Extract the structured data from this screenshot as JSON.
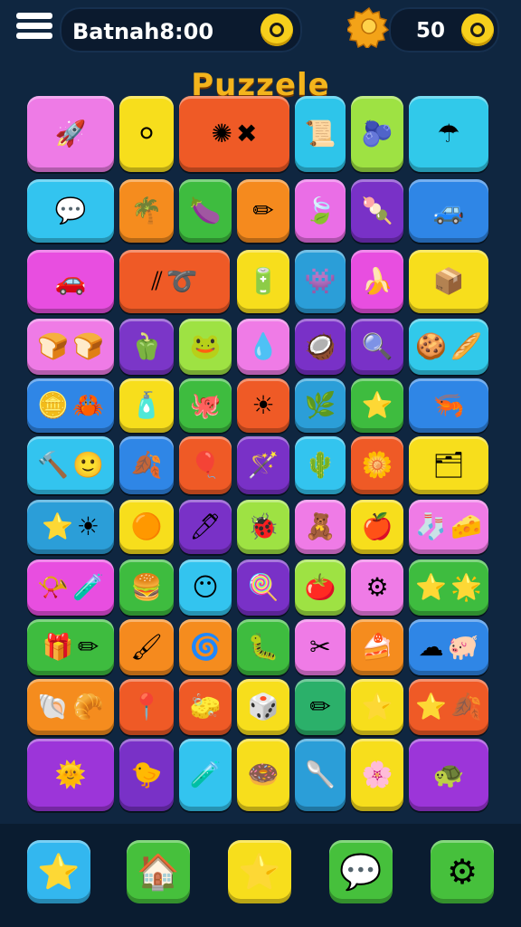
{
  "header": {
    "title_text": "Batnah8:00",
    "coins": "50"
  },
  "game_title": "Puzzele",
  "colors": {
    "background": "#0f2640",
    "title": "#f3b41c"
  },
  "tiles": [
    {
      "color": "#ee7be6",
      "icons": [
        "rocket-icon"
      ],
      "glyphs": [
        "🚀"
      ]
    },
    {
      "color": "#f7de1c",
      "icons": [
        "egg-icon"
      ],
      "glyphs": [
        "⚪"
      ]
    },
    {
      "color": "#ef5a26",
      "icons": [
        "virus-icon",
        "cross-icon"
      ],
      "glyphs": [
        "✺",
        "✖"
      ]
    },
    {
      "color": "#2ec5ea",
      "icons": [
        "scroll-icon"
      ],
      "glyphs": [
        "📜"
      ]
    },
    {
      "color": "#9ee243",
      "icons": [
        "berry-icon"
      ],
      "glyphs": [
        "🫐"
      ]
    },
    {
      "color": "#31c9ea",
      "icons": [
        "umbrella-icon"
      ],
      "glyphs": [
        "☂"
      ]
    },
    {
      "color": "#33c4ef",
      "icons": [
        "chat-bubble-icon"
      ],
      "glyphs": [
        "💬"
      ]
    },
    {
      "color": "#f58c1e",
      "icons": [
        "palm-icon"
      ],
      "glyphs": [
        "🌴"
      ]
    },
    {
      "color": "#3ebc3f",
      "icons": [
        "eggplant-icon"
      ],
      "glyphs": [
        "🍆"
      ]
    },
    {
      "color": "#f58a1e",
      "icons": [
        "pencil-icon"
      ],
      "glyphs": [
        "✏"
      ]
    },
    {
      "color": "#ea6ee6",
      "icons": [
        "leaf-icon"
      ],
      "glyphs": [
        "🍃"
      ]
    },
    {
      "color": "#7931c7",
      "icons": [
        "ice-pop-icon"
      ],
      "glyphs": [
        "🍡"
      ]
    },
    {
      "color": "#2f86e6",
      "icons": [
        "toy-car-icon"
      ],
      "glyphs": [
        "🚙"
      ]
    },
    {
      "color": "#e84ee0",
      "icons": [
        "car-icon"
      ],
      "glyphs": [
        "🚗"
      ]
    },
    {
      "color": "#ef5a26",
      "icons": [
        "sticks-icon",
        "rope-icon"
      ],
      "glyphs": [
        "⫽",
        "➰"
      ]
    },
    {
      "color": "#f7de1c",
      "icons": [
        "battery-icon"
      ],
      "glyphs": [
        "🔋"
      ]
    },
    {
      "color": "#2b9ed8",
      "icons": [
        "alien-icon"
      ],
      "glyphs": [
        "👾"
      ]
    },
    {
      "color": "#e84ee0",
      "icons": [
        "banana-icon"
      ],
      "glyphs": [
        "🍌"
      ]
    },
    {
      "color": "#f7de1c",
      "icons": [
        "box-icon"
      ],
      "glyphs": [
        "📦"
      ]
    },
    {
      "color": "#ef7be6",
      "icons": [
        "bread-icon",
        "bread-icon"
      ],
      "glyphs": [
        "🍞",
        "🍞"
      ]
    },
    {
      "color": "#7b36c8",
      "icons": [
        "pepper-icon"
      ],
      "glyphs": [
        "🫑"
      ]
    },
    {
      "color": "#9ee243",
      "icons": [
        "bird-icon"
      ],
      "glyphs": [
        "🐸"
      ]
    },
    {
      "color": "#ef7be6",
      "icons": [
        "drop-icon"
      ],
      "glyphs": [
        "💧"
      ]
    },
    {
      "color": "#7931c7",
      "icons": [
        "coconut-icon"
      ],
      "glyphs": [
        "🥥"
      ]
    },
    {
      "color": "#7931c7",
      "icons": [
        "magnifier-icon"
      ],
      "glyphs": [
        "🔍"
      ]
    },
    {
      "color": "#31c9ea",
      "icons": [
        "cookie-icon",
        "cookie-icon"
      ],
      "glyphs": [
        "🍪",
        "🥖"
      ]
    },
    {
      "color": "#2f86e6",
      "icons": [
        "coin-icon",
        "crab-icon"
      ],
      "glyphs": [
        "🪙",
        "🦀"
      ]
    },
    {
      "color": "#f7de1c",
      "icons": [
        "bottle-icon"
      ],
      "glyphs": [
        "🧴"
      ]
    },
    {
      "color": "#3ebc3f",
      "icons": [
        "octopus-icon"
      ],
      "glyphs": [
        "🐙"
      ]
    },
    {
      "color": "#ef5a26",
      "icons": [
        "sun-icon"
      ],
      "glyphs": [
        "☀"
      ]
    },
    {
      "color": "#2b9ed8",
      "icons": [
        "leaf-icon"
      ],
      "glyphs": [
        "🌿"
      ]
    },
    {
      "color": "#3ebc3f",
      "icons": [
        "star-icon"
      ],
      "glyphs": [
        "⭐"
      ]
    },
    {
      "color": "#2f86e6",
      "icons": [
        "shrimp-icon"
      ],
      "glyphs": [
        "🦐"
      ]
    },
    {
      "color": "#33c4ef",
      "icons": [
        "hammer-icon",
        "smiley-icon"
      ],
      "glyphs": [
        "🔨",
        "🙂"
      ]
    },
    {
      "color": "#2f86e6",
      "icons": [
        "leaf-drop-icon"
      ],
      "glyphs": [
        "🍂"
      ]
    },
    {
      "color": "#ef5a26",
      "icons": [
        "bulb-icon"
      ],
      "glyphs": [
        "🎈"
      ]
    },
    {
      "color": "#7931c7",
      "icons": [
        "wand-icon"
      ],
      "glyphs": [
        "🪄"
      ]
    },
    {
      "color": "#33c4ef",
      "icons": [
        "cactus-icon"
      ],
      "glyphs": [
        "🌵"
      ]
    },
    {
      "color": "#ef5a26",
      "icons": [
        "flower-icon"
      ],
      "glyphs": [
        "🌼"
      ]
    },
    {
      "color": "#f7de1c",
      "icons": [
        "card-icon"
      ],
      "glyphs": [
        "🗂"
      ]
    },
    {
      "color": "#2b9ed8",
      "icons": [
        "star-icon",
        "sun-icon"
      ],
      "glyphs": [
        "⭐",
        "☀"
      ]
    },
    {
      "color": "#f7de1c",
      "icons": [
        "balloon-icon"
      ],
      "glyphs": [
        "🟠"
      ]
    },
    {
      "color": "#7931c7",
      "icons": [
        "pen-icon"
      ],
      "glyphs": [
        "🖊"
      ]
    },
    {
      "color": "#9ee243",
      "icons": [
        "bug-icon"
      ],
      "glyphs": [
        "🐞"
      ]
    },
    {
      "color": "#ef7be6",
      "icons": [
        "toy-icon"
      ],
      "glyphs": [
        "🧸"
      ]
    },
    {
      "color": "#f7de1c",
      "icons": [
        "apple-icon"
      ],
      "glyphs": [
        "🍎"
      ]
    },
    {
      "color": "#ef7be6",
      "icons": [
        "socks-icon",
        "bread-icon"
      ],
      "glyphs": [
        "🧦",
        "🧀"
      ]
    },
    {
      "color": "#e84ee0",
      "icons": [
        "horn-icon",
        "pipe-icon"
      ],
      "glyphs": [
        "📯",
        "🧪"
      ]
    },
    {
      "color": "#3ebc3f",
      "icons": [
        "burger-icon"
      ],
      "glyphs": [
        "🍔"
      ]
    },
    {
      "color": "#33c4ef",
      "icons": [
        "face-icon"
      ],
      "glyphs": [
        "😶"
      ]
    },
    {
      "color": "#7931c7",
      "icons": [
        "lollipop-icon"
      ],
      "glyphs": [
        "🍭"
      ]
    },
    {
      "color": "#9ee243",
      "icons": [
        "apple-icon"
      ],
      "glyphs": [
        "🍅"
      ]
    },
    {
      "color": "#ef7be6",
      "icons": [
        "gear-icon"
      ],
      "glyphs": [
        "⚙"
      ]
    },
    {
      "color": "#3ebc3f",
      "icons": [
        "starfish-icon",
        "starfish-icon"
      ],
      "glyphs": [
        "⭐",
        "🌟"
      ]
    },
    {
      "color": "#3ebc3f",
      "icons": [
        "box-icon",
        "pencil-icon"
      ],
      "glyphs": [
        "🎁",
        "✏"
      ]
    },
    {
      "color": "#f58a1e",
      "icons": [
        "brush-icon"
      ],
      "glyphs": [
        "🖌"
      ]
    },
    {
      "color": "#f58c1e",
      "icons": [
        "swirl-icon"
      ],
      "glyphs": [
        "🌀"
      ]
    },
    {
      "color": "#3ebc3f",
      "icons": [
        "worm-icon"
      ],
      "glyphs": [
        "🐛"
      ]
    },
    {
      "color": "#ef7be6",
      "icons": [
        "scissors-icon"
      ],
      "glyphs": [
        "✂"
      ]
    },
    {
      "color": "#f58c1e",
      "icons": [
        "cake-icon"
      ],
      "glyphs": [
        "🍰"
      ]
    },
    {
      "color": "#2f86e6",
      "icons": [
        "cloud-icon",
        "pig-icon"
      ],
      "glyphs": [
        "☁",
        "🐖"
      ]
    },
    {
      "color": "#f58c1e",
      "icons": [
        "snail-icon",
        "bread-icon"
      ],
      "glyphs": [
        "🐚",
        "🥐"
      ]
    },
    {
      "color": "#ef5a26",
      "icons": [
        "pin-icon"
      ],
      "glyphs": [
        "📍"
      ]
    },
    {
      "color": "#ef5a26",
      "icons": [
        "eraser-icon"
      ],
      "glyphs": [
        "🧽"
      ]
    },
    {
      "color": "#f7de1c",
      "icons": [
        "cube-icon"
      ],
      "glyphs": [
        "🎲"
      ]
    },
    {
      "color": "#2bb06a",
      "icons": [
        "pencil-icon"
      ],
      "glyphs": [
        "✏"
      ]
    },
    {
      "color": "#f7de1c",
      "icons": [
        "star-icon"
      ],
      "glyphs": [
        "⭐"
      ]
    },
    {
      "color": "#ef5a26",
      "icons": [
        "star-icon",
        "leaf-icon"
      ],
      "glyphs": [
        "⭐",
        "🍂"
      ]
    },
    {
      "color": "#9c35d9",
      "icons": [
        "sun-star-icon"
      ],
      "glyphs": [
        "🌞"
      ]
    },
    {
      "color": "#7931c7",
      "icons": [
        "bird-icon"
      ],
      "glyphs": [
        "🐤"
      ]
    },
    {
      "color": "#33c4ef",
      "icons": [
        "tube-icon"
      ],
      "glyphs": [
        "🧪"
      ]
    },
    {
      "color": "#f7de1c",
      "icons": [
        "ring-icon"
      ],
      "glyphs": [
        "🍩"
      ]
    },
    {
      "color": "#2b9ed8",
      "icons": [
        "matchstick-icon"
      ],
      "glyphs": [
        "🥄"
      ]
    },
    {
      "color": "#f7de1c",
      "icons": [
        "flower-icon"
      ],
      "glyphs": [
        "🌸"
      ]
    },
    {
      "color": "#9c35d9",
      "icons": [
        "turtle-icon"
      ],
      "glyphs": [
        "🐢"
      ]
    }
  ],
  "bottom_nav": [
    {
      "name": "star-button",
      "color": "#33b7ef",
      "glyph": "⭐"
    },
    {
      "name": "home-button",
      "color": "#46c03c",
      "glyph": "🏠"
    },
    {
      "name": "favorites-button",
      "color": "#f7de1c",
      "glyph": "⭐"
    },
    {
      "name": "chat-button",
      "color": "#46c03c",
      "glyph": "💬"
    },
    {
      "name": "settings-button",
      "color": "#46c03c",
      "glyph": "⚙"
    }
  ]
}
